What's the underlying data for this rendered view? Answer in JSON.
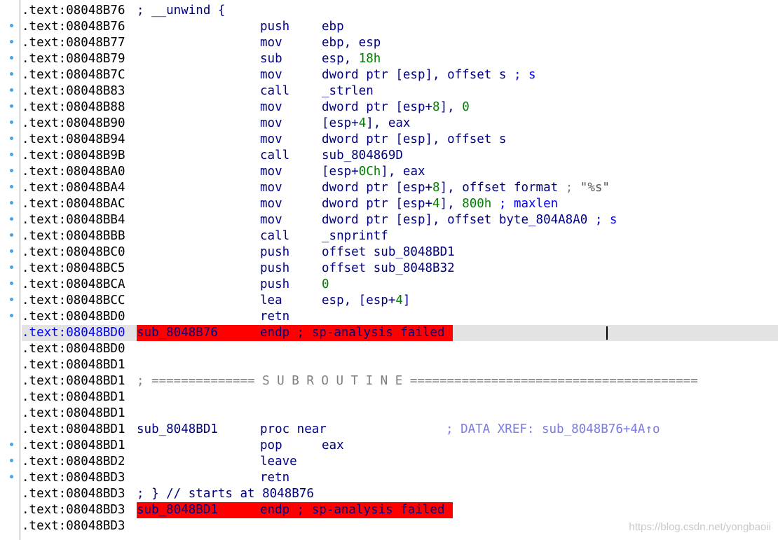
{
  "rows": [
    {
      "addr": ".text:08048B76",
      "label": "; __unwind {"
    },
    {
      "addr": ".text:08048B76",
      "mnem": "push",
      "op": "ebp"
    },
    {
      "addr": ".text:08048B77",
      "mnem": "mov",
      "op": "ebp, esp"
    },
    {
      "addr": ".text:08048B79",
      "mnem": "sub",
      "op": "esp, ",
      "num": "18h"
    },
    {
      "addr": ".text:08048B7C",
      "mnem": "mov",
      "op": "dword ptr [esp], offset s",
      "cmt": " ; s"
    },
    {
      "addr": ".text:08048B83",
      "mnem": "call",
      "op": "_strlen"
    },
    {
      "addr": ".text:08048B88",
      "mnem": "mov",
      "op": "dword ptr [esp+",
      "num": "8",
      "op2": "], ",
      "num2": "0"
    },
    {
      "addr": ".text:08048B90",
      "mnem": "mov",
      "op": "[esp+",
      "num": "4",
      "op2": "], eax"
    },
    {
      "addr": ".text:08048B94",
      "mnem": "mov",
      "op": "dword ptr [esp], offset s"
    },
    {
      "addr": ".text:08048B9B",
      "mnem": "call",
      "op": "sub_804869D"
    },
    {
      "addr": ".text:08048BA0",
      "mnem": "mov",
      "op": "[esp+",
      "num": "0Ch",
      "op2": "], eax"
    },
    {
      "addr": ".text:08048BA4",
      "mnem": "mov",
      "op": "dword ptr [esp+",
      "num": "8",
      "op2": "], offset format",
      "cmt": " ; ",
      "str": "\"%s\""
    },
    {
      "addr": ".text:08048BAC",
      "mnem": "mov",
      "op": "dword ptr [esp+",
      "num": "4",
      "op2": "], ",
      "num2": "800h",
      "cmt": " ; maxlen"
    },
    {
      "addr": ".text:08048BB4",
      "mnem": "mov",
      "op": "dword ptr [esp], offset byte_804A8A0",
      "cmt": " ; s"
    },
    {
      "addr": ".text:08048BBB",
      "mnem": "call",
      "op": "_snprintf"
    },
    {
      "addr": ".text:08048BC0",
      "mnem": "push",
      "op": "offset sub_8048BD1"
    },
    {
      "addr": ".text:08048BC5",
      "mnem": "push",
      "op": "offset sub_8048B32"
    },
    {
      "addr": ".text:08048BCA",
      "mnem": "push",
      "num": "0"
    },
    {
      "addr": ".text:08048BCC",
      "mnem": "lea",
      "op": "esp, [esp+",
      "num": "4",
      "op2": "]"
    },
    {
      "addr": ".text:08048BD0",
      "mnem": "retn"
    },
    {
      "addr": ".text:08048BD0",
      "label": "sub_8048B76",
      "mnem": "endp ; sp-analysis failed"
    },
    {
      "addr": ".text:08048BD0"
    },
    {
      "addr": ".text:08048BD1"
    },
    {
      "addr": ".text:08048BD1",
      "sep": "; ============== S U B R O U T I N E ======================================="
    },
    {
      "addr": ".text:08048BD1"
    },
    {
      "addr": ".text:08048BD1"
    },
    {
      "addr": ".text:08048BD1",
      "label": "sub_8048BD1",
      "mnem": "proc near",
      "xref": "; DATA XREF: sub_8048B76+4A↑o"
    },
    {
      "addr": ".text:08048BD1",
      "mnem": "pop",
      "op": "eax"
    },
    {
      "addr": ".text:08048BD2",
      "mnem": "leave"
    },
    {
      "addr": ".text:08048BD3",
      "mnem": "retn"
    },
    {
      "addr": ".text:08048BD3",
      "label": "; } // starts at 8048B76"
    },
    {
      "addr": ".text:08048BD3",
      "label": "sub_8048BD1",
      "mnem": "endp ; sp-analysis failed"
    },
    {
      "addr": ".text:08048BD3"
    }
  ],
  "watermark": "https://blog.csdn.net/yongbaoii"
}
